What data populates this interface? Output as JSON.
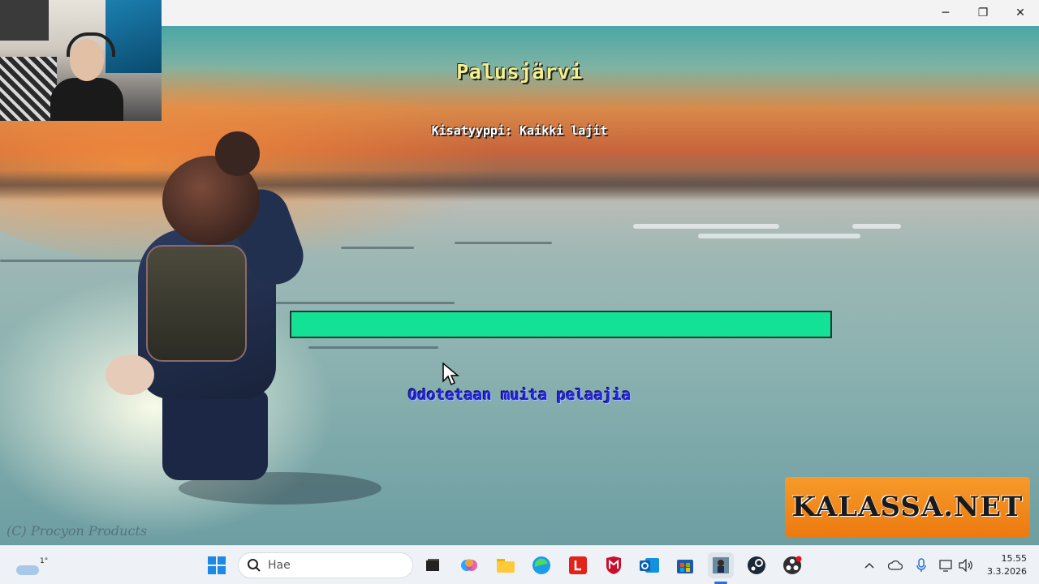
{
  "window": {
    "controls": {
      "minimize": "─",
      "maximize": "❐",
      "close": "✕"
    }
  },
  "game": {
    "lake_name": "Palusjärvi",
    "contest_type": "Kisatyyppi: Kaikki lajit",
    "progress_percent": 100,
    "status_message": "Odotetaan muita pelaajia",
    "copyright": "(C) Procyon Products",
    "logo_text": "KALASSA.NET"
  },
  "taskbar": {
    "weather_temp": "1°",
    "search_placeholder": "Hae",
    "apps": [
      {
        "name": "task-view-icon"
      },
      {
        "name": "copilot-icon"
      },
      {
        "name": "file-explorer-icon"
      },
      {
        "name": "edge-icon"
      },
      {
        "name": "lenovo-icon"
      },
      {
        "name": "mcafee-icon"
      },
      {
        "name": "outlook-icon"
      },
      {
        "name": "microsoft-store-icon"
      },
      {
        "name": "kalassa-game-icon"
      },
      {
        "name": "steam-icon"
      },
      {
        "name": "obs-icon"
      }
    ],
    "time": "15.55",
    "date": "3.3.2026"
  },
  "colors": {
    "progress_bar": "#12e196",
    "title_yellow": "#f4f08a",
    "status_blue": "#2626d6",
    "logo_orange": "#f08a1c"
  }
}
